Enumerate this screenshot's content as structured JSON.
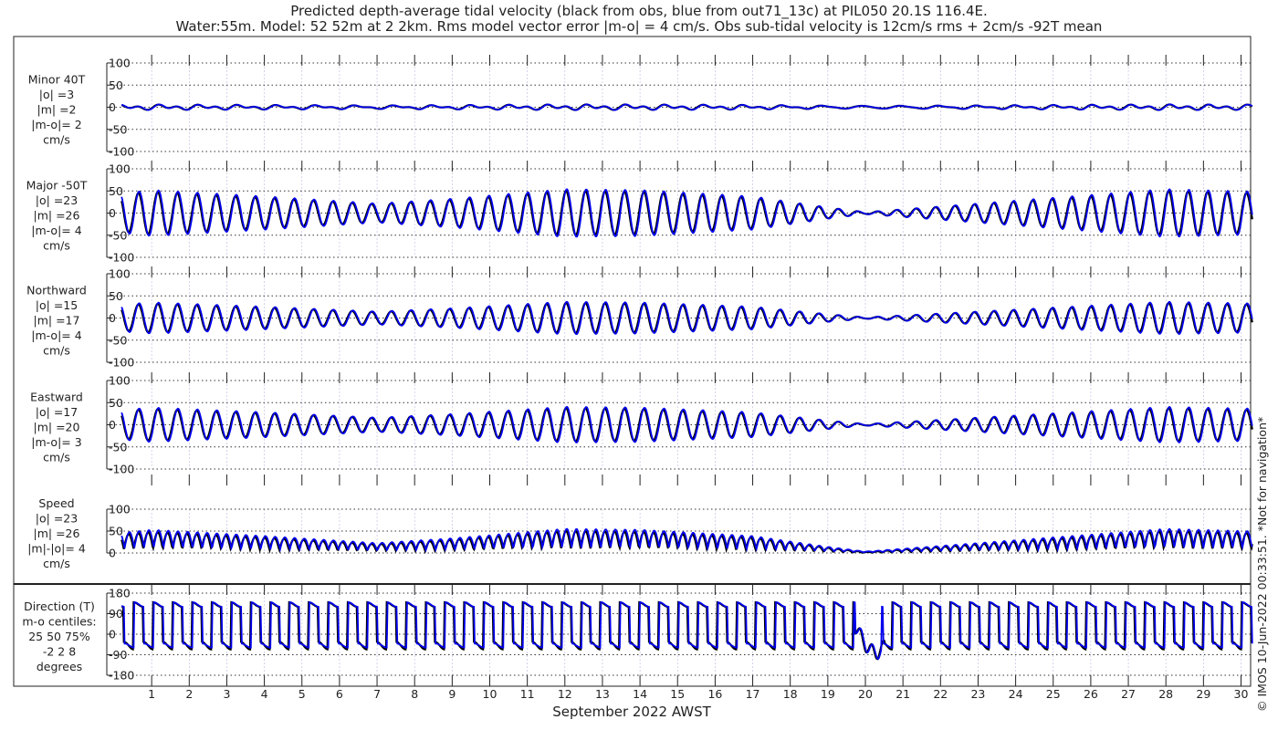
{
  "title_line1": "Predicted depth-average tidal velocity (black from obs, blue from out71_13c) at PIL050 20.1S 116.4E.",
  "title_line2": "Water:55m. Model: 52 52m at 2 2km. Rms model vector error |m-o| = 4 cm/s. Obs sub-tidal velocity is 12cm/s rms + 2cm/s -92T mean",
  "copyright": "© IMOS 10-Jun-2022 00:33:51. *Not for navigation*",
  "colors": {
    "obs": "#000000",
    "model": "#0000ee"
  },
  "chart_data": {
    "type": "line",
    "xlabel": "September 2022 AWST",
    "xlim": [
      0,
      30.3
    ],
    "xticks": [
      "1",
      "2",
      "3",
      "4",
      "5",
      "6",
      "7",
      "8",
      "9",
      "10",
      "11",
      "12",
      "13",
      "14",
      "15",
      "16",
      "17",
      "18",
      "19",
      "20",
      "21",
      "22",
      "23",
      "24",
      "25",
      "26",
      "27",
      "28",
      "29",
      "30"
    ],
    "envelope_days": [
      0,
      1,
      4,
      7,
      9,
      12,
      14,
      17,
      19,
      20,
      21,
      23,
      26,
      28,
      30.3
    ],
    "envelope_major_cm_s": [
      40,
      48,
      35,
      20,
      30,
      50,
      48,
      35,
      12,
      2,
      8,
      20,
      38,
      50,
      45
    ],
    "panels": [
      {
        "name": "minor",
        "label": [
          "Minor 40T",
          "|o| =3",
          "|m| =2",
          "|m-o|= 2",
          "cm/s"
        ],
        "ylim": [
          -100,
          100
        ],
        "yticks": [
          "100",
          "50",
          "0",
          "-50",
          "-100"
        ],
        "amp_ratio": 0.08
      },
      {
        "name": "major",
        "label": [
          "Major -50T",
          "|o| =23",
          "|m| =26",
          "|m-o|= 4",
          "cm/s"
        ],
        "ylim": [
          -100,
          100
        ],
        "yticks": [
          "100",
          "50",
          "0",
          "-50",
          "-100"
        ],
        "amp_ratio": 1.0
      },
      {
        "name": "northward",
        "label": [
          "Northward",
          "|o| =15",
          "|m| =17",
          "|m-o|= 4",
          "cm/s"
        ],
        "ylim": [
          -100,
          100
        ],
        "yticks": [
          "100",
          "50",
          "0",
          "-50",
          "-100"
        ],
        "amp_ratio": 0.68
      },
      {
        "name": "eastward",
        "label": [
          "Eastward",
          "|o| =17",
          "|m| =20",
          "|m-o|= 3",
          "cm/s"
        ],
        "ylim": [
          -100,
          100
        ],
        "yticks": [
          "100",
          "50",
          "0",
          "-50",
          "-100"
        ],
        "amp_ratio": 0.75
      },
      {
        "name": "speed",
        "label": [
          "Speed",
          "|o| =23",
          "|m| =26",
          "|m|-|o|= 4",
          "cm/s"
        ],
        "ylim": [
          0,
          100
        ],
        "yticks": [
          "100",
          "50",
          "0"
        ],
        "amp_ratio": 1.0
      },
      {
        "name": "direction",
        "label": [
          "Direction (T)",
          "m-o centiles:",
          "25  50  75%",
          "-2  2  8",
          "degrees"
        ],
        "ylim": [
          -180,
          180
        ],
        "yticks": [
          "180",
          "90",
          "0",
          "-90",
          "-180"
        ],
        "amp_ratio": 1.0
      }
    ]
  }
}
